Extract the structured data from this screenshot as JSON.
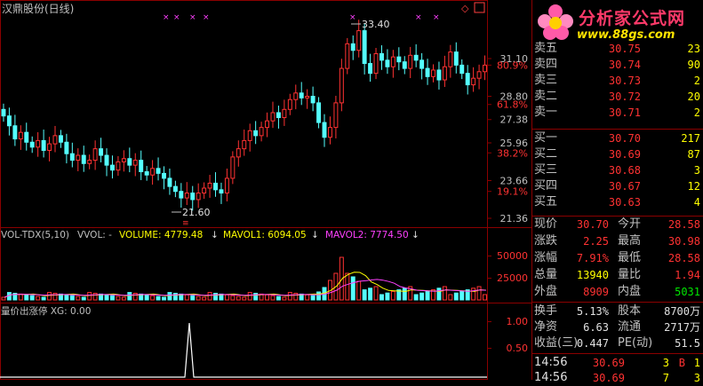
{
  "header": {
    "stock_title": "汉鼎股份(日线)",
    "peak_label": "33.40",
    "trough_label": "21.60"
  },
  "price_axis": {
    "labels": [
      {
        "text": "31.10",
        "price": 31.1,
        "color": "#c0c0c0"
      },
      {
        "text": "80.9%",
        "price": 30.7,
        "color": "#ff3232"
      },
      {
        "text": "28.80",
        "price": 28.8,
        "color": "#c0c0c0"
      },
      {
        "text": "61.8%",
        "price": 28.3,
        "color": "#ff3232"
      },
      {
        "text": "27.38",
        "price": 27.38,
        "color": "#c0c0c0"
      },
      {
        "text": "25.96",
        "price": 25.96,
        "color": "#c0c0c0"
      },
      {
        "text": "38.2%",
        "price": 25.35,
        "color": "#ff3232"
      },
      {
        "text": "23.66",
        "price": 23.66,
        "color": "#c0c0c0"
      },
      {
        "text": "19.1%",
        "price": 23.0,
        "color": "#ff3232"
      },
      {
        "text": "21.36",
        "price": 21.36,
        "color": "#c0c0c0"
      }
    ]
  },
  "volume_panel": {
    "label_indicator": "VOL-TDX(5,10)",
    "label_vvol": "VVOL: -",
    "label_volume": "VOLUME: 4779.48",
    "label_mavol1": "MAVOL1: 6094.05",
    "label_mavol2": "MAVOL2: 7774.50",
    "axis_labels": [
      "50000",
      "25000"
    ]
  },
  "signal_panel": {
    "label": "量价出涨停  XG: 0.00",
    "axis_labels": [
      "1.00",
      "0.50"
    ]
  },
  "logo": {
    "title": "分析家公式网",
    "url": "www.88gs.com"
  },
  "order_book": {
    "asks": [
      {
        "label": "卖五",
        "price": "30.75",
        "qty": "23"
      },
      {
        "label": "卖四",
        "price": "30.74",
        "qty": "90"
      },
      {
        "label": "卖三",
        "price": "30.73",
        "qty": "2"
      },
      {
        "label": "卖二",
        "price": "30.72",
        "qty": "20"
      },
      {
        "label": "卖一",
        "price": "30.71",
        "qty": "2"
      }
    ],
    "bids": [
      {
        "label": "买一",
        "price": "30.70",
        "qty": "217"
      },
      {
        "label": "买二",
        "price": "30.69",
        "qty": "87"
      },
      {
        "label": "买三",
        "price": "30.68",
        "qty": "3"
      },
      {
        "label": "买四",
        "price": "30.67",
        "qty": "12"
      },
      {
        "label": "买五",
        "price": "30.63",
        "qty": "4"
      }
    ]
  },
  "quote": {
    "rows": [
      {
        "l1": "现价",
        "v1": "30.70",
        "c1": "red",
        "l2": "今开",
        "v2": "28.58",
        "c2": "red"
      },
      {
        "l1": "涨跌",
        "v1": "2.25",
        "c1": "red",
        "l2": "最高",
        "v2": "30.98",
        "c2": "red"
      },
      {
        "l1": "涨幅",
        "v1": "7.91%",
        "c1": "red",
        "l2": "最低",
        "v2": "28.58",
        "c2": "red"
      },
      {
        "l1": "总量",
        "v1": "13940",
        "c1": "yel",
        "l2": "量比",
        "v2": "1.94",
        "c2": "red"
      },
      {
        "l1": "外盘",
        "v1": "8909",
        "c1": "red",
        "l2": "内盘",
        "v2": "5031",
        "c2": "grn"
      }
    ],
    "stats": [
      {
        "l1": "换手",
        "v1": "5.13%",
        "l2": "股本",
        "v2": "8700万"
      },
      {
        "l1": "净资",
        "v1": "6.63",
        "l2": "流通",
        "v2": "2717万"
      },
      {
        "l1": "收益(三)",
        "v1": "0.447",
        "l2": "PE(动)",
        "v2": "51.5"
      }
    ],
    "ticks": [
      {
        "time": "14:56",
        "price": "30.69",
        "vol": "3",
        "side": "B",
        "side_color": "red",
        "count": "1"
      },
      {
        "time": "14:56",
        "price": "30.69",
        "vol": "7",
        "side": "",
        "side_color": "red",
        "count": "3"
      }
    ]
  },
  "colors": {
    "up": "#ff3232",
    "down": "#54ffff",
    "grid": "#8b0000",
    "ma_fast": "#ffff00",
    "ma_slow": "#ff00ff"
  }
}
